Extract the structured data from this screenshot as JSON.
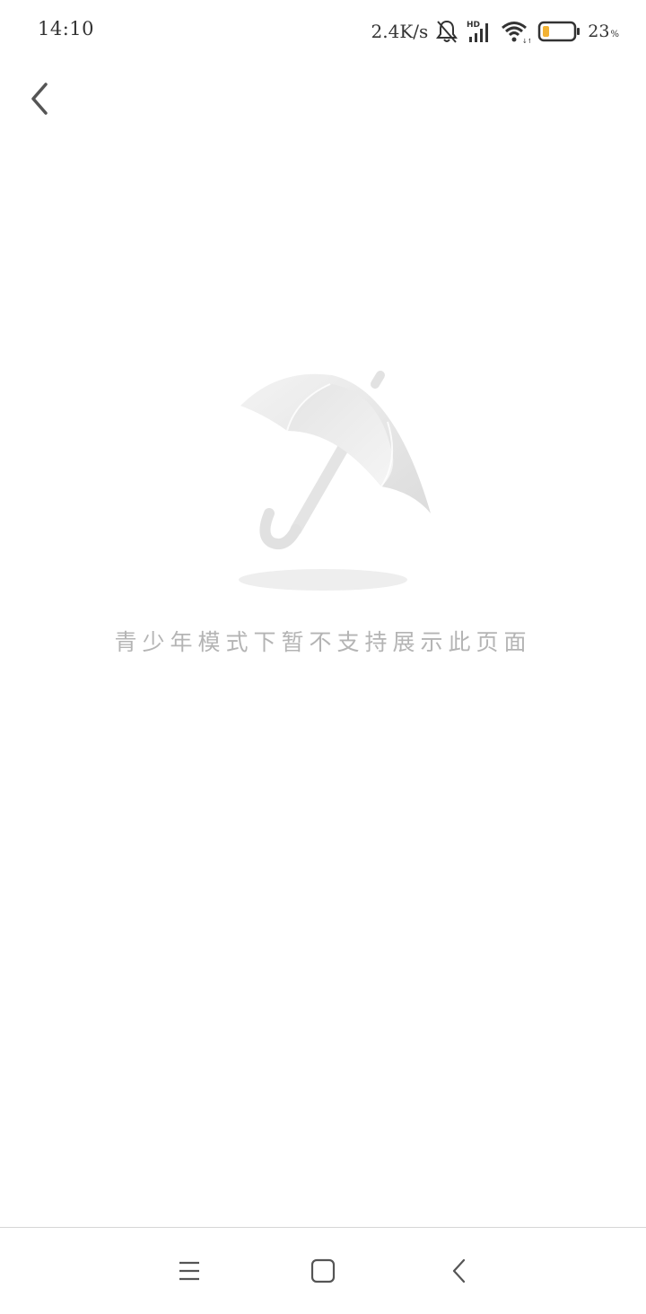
{
  "status_bar": {
    "time": "14:10",
    "net_speed": "2.4K/s",
    "battery_percent": "23",
    "battery_unit": "%",
    "battery_level": 0.23,
    "battery_fill_color": "#f2b233",
    "icons": [
      "bell-muted-icon",
      "hd-signal-icon",
      "wifi-icon",
      "battery-icon"
    ]
  },
  "header": {
    "back_icon": "chevron-left-icon"
  },
  "empty_state": {
    "illustration": "umbrella-icon",
    "message": "青少年模式下暂不支持展示此页面"
  },
  "nav_bar": {
    "items": [
      {
        "name": "menu",
        "icon": "menu-icon"
      },
      {
        "name": "home",
        "icon": "home-square-icon"
      },
      {
        "name": "back",
        "icon": "back-chevron-icon"
      }
    ]
  },
  "colors": {
    "background": "#ffffff",
    "text_primary": "#333333",
    "message_text": "#b4b4b4",
    "illustration_gray": "#e6e6e6"
  }
}
